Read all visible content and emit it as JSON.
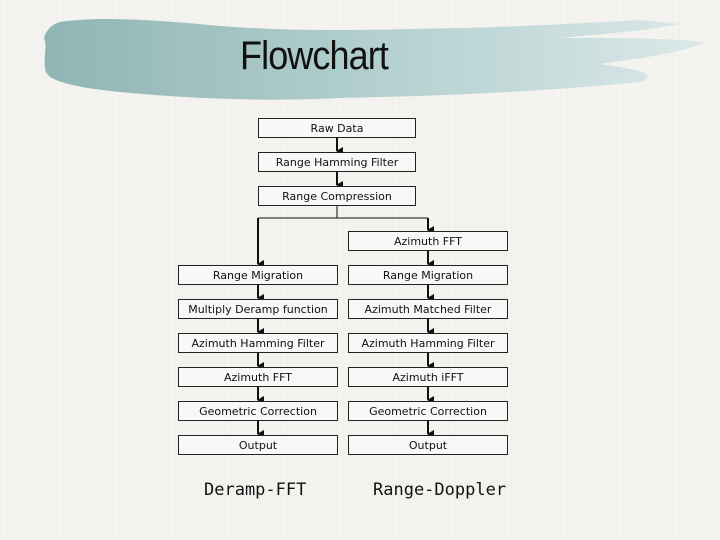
{
  "title": "Flowchart",
  "colors": {
    "brush_dark": "#8fb5b4",
    "brush_light": "#d6e6e6",
    "background": "#f4f3ef",
    "line": "#111111"
  },
  "common_steps": [
    "Raw Data",
    "Range Hamming Filter",
    "Range Compression"
  ],
  "left_branch": {
    "name": "Deramp-FFT",
    "steps": [
      "Range Migration",
      "Multiply Deramp function",
      "Azimuth Hamming Filter",
      "Azimuth FFT",
      "Geometric Correction",
      "Output"
    ]
  },
  "right_branch": {
    "name": "Range-Doppler",
    "steps": [
      "Azimuth FFT",
      "Range Migration",
      "Azimuth Matched Filter",
      "Azimuth Hamming Filter",
      "Azimuth iFFT",
      "Geometric Correction",
      "Output"
    ]
  }
}
